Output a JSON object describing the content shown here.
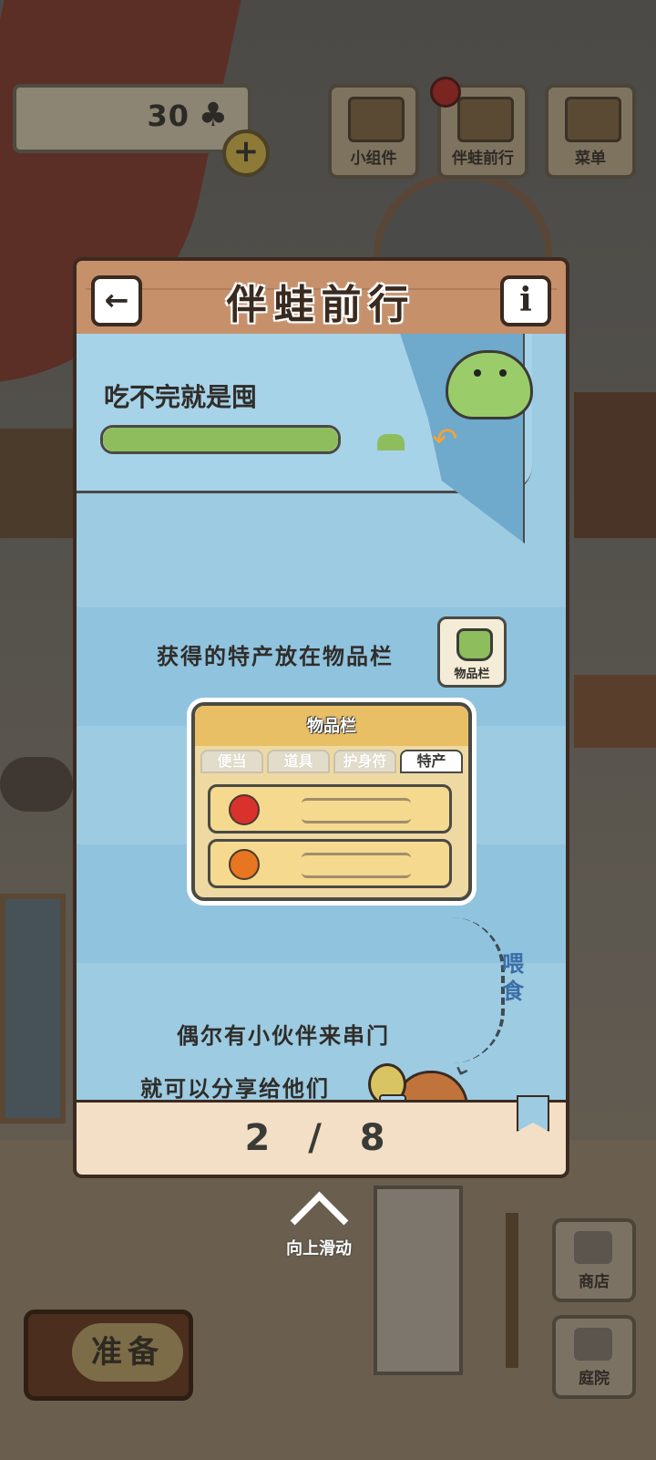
{
  "hud": {
    "clover_count": "30",
    "clover_icon": "clover-icon",
    "plus_symbol": "+",
    "buttons": [
      {
        "label": "小组件",
        "icon": "widget-house-icon"
      },
      {
        "label": "伴蛙前行",
        "icon": "journey-book-icon"
      },
      {
        "label": "菜单",
        "icon": "menu-cards-icon"
      }
    ],
    "side_buttons": [
      {
        "label": "商店",
        "icon": "shop-icon"
      },
      {
        "label": "庭院",
        "icon": "yard-mailbox-icon"
      }
    ],
    "prepare_label": "准备"
  },
  "modal": {
    "title": "伴蛙前行",
    "back_symbol": "←",
    "info_symbol": "i",
    "goal_title": "吃不完就是囤",
    "goal_progress": 1.0,
    "inventory_hint": "获得的特产放在物品栏",
    "inventory_button_label": "物品栏",
    "illustration": {
      "panel_title": "物品栏",
      "tabs": [
        "便当",
        "道具",
        "护身符",
        "特产"
      ],
      "active_tab": "特产",
      "items": [
        {
          "name": "apple",
          "color": "#d9312c"
        },
        {
          "name": "persimmon",
          "color": "#e8751f"
        }
      ]
    },
    "feed_label": "喂食",
    "visit_text": "偶尔有小伙伴来串门",
    "share_text": "就可以分享给他们",
    "page_indicator": "2 / 8"
  },
  "swipe_hint": "向上滑动",
  "colors": {
    "panel_blue": "#9ccbe2",
    "progress_green": "#8dbd5c",
    "header_wood": "#c5906a",
    "footer_cream": "#f2dfc6"
  }
}
